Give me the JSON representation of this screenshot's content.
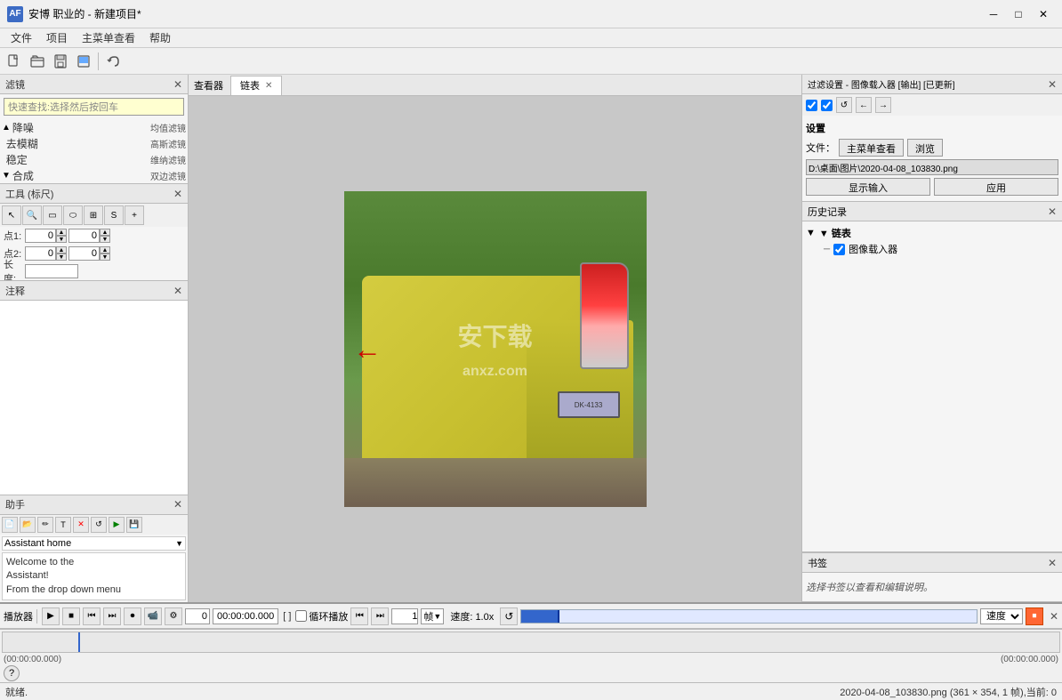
{
  "titleBar": {
    "icon": "AF",
    "title": "安博 职业的 - 新建项目*",
    "minimize": "─",
    "maximize": "□",
    "close": "✕"
  },
  "menuBar": {
    "items": [
      "文件",
      "项目",
      "主菜单查看",
      "帮助"
    ]
  },
  "toolbar": {
    "buttons": [
      "new",
      "open",
      "save",
      "export",
      "undo"
    ]
  },
  "filterPanel": {
    "title": "滤镜",
    "searchPlaceholder": "快速查找:选择然后按回车",
    "searchValue": "快速查找:选择然后按回车",
    "items": [
      {
        "label": "降噪",
        "expand": "▲",
        "value": "均值滤镜"
      },
      {
        "label": "去模糊",
        "expand": "",
        "value": "高斯滤镜"
      },
      {
        "label": "稳定",
        "expand": "",
        "value": "维纳滤镜"
      },
      {
        "label": "合成",
        "expand": "▼",
        "value": "双边滤镜"
      }
    ]
  },
  "toolsPanel": {
    "title": "工具 (标尺)",
    "point1Label": "点1:",
    "point1x": "0",
    "point1y": "0",
    "point2Label": "点2:",
    "point2x": "0",
    "point2y": "0",
    "lengthLabel": "长度:",
    "lengthValue": ""
  },
  "notesPanel": {
    "title": "注释"
  },
  "assistantPanel": {
    "title": "助手",
    "dropdownLabel": "Assistant home",
    "text": "Welcome to the\nAssistant!\nFrom the drop down menu"
  },
  "chainViewer": {
    "title": "查看器",
    "tab": "链表",
    "arrowLabel": "←"
  },
  "rightPanel": {
    "filterSettings": {
      "title": "过滤设置 - 图像载入器 [输出] [已更新]",
      "checkboxes": [
        "☑",
        "☑"
      ],
      "buttons": [
        "↺",
        "←",
        "→"
      ],
      "settingsLabel": "设置",
      "fileLabel": "文件：",
      "browseBtn": "主菜单查看",
      "browseBtn2": "浏览",
      "filePath": "D:\\桌面\\图片\\2020-04-08_103830.png",
      "showInputBtn": "显示输入",
      "applyBtn": "应用"
    },
    "historyPanel": {
      "title": "历史记录",
      "chainLabel": "▼ 链表",
      "imageLoader": "图像载入器"
    },
    "bookmarkPanel": {
      "title": "书签",
      "emptyText": "选择书签以查看和编辑说明。"
    }
  },
  "playbackBar": {
    "frameValue": "0",
    "timeValue": "00:00:00.000",
    "loopLabel": "循环播放",
    "frameCount": "1",
    "frameUnit": "帧",
    "speedLabel": "速度: 1.0x",
    "speedOption": "速度"
  },
  "statusBar": {
    "left": "就绪.",
    "right": "2020-04-08_103830.png (361 × 354, 1 帧),当前: 0"
  }
}
